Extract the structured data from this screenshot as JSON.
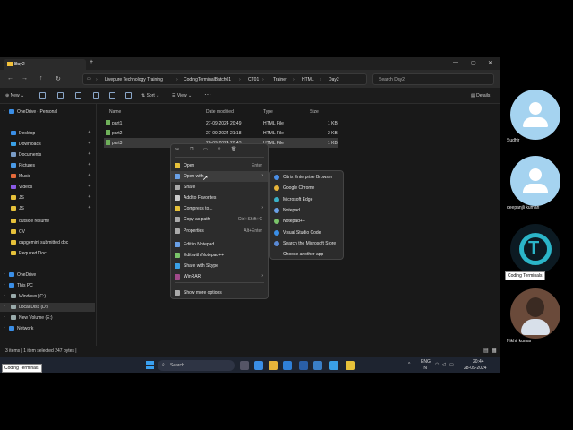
{
  "explorer": {
    "tab_title": "Day2",
    "tab_close": "✕",
    "new_tab": "+",
    "window_controls": [
      "—",
      "▢",
      "✕"
    ],
    "breadcrumb": [
      "Livepure Technology Training",
      "CodingTerminalBatch01",
      "CT01",
      "Trainer",
      "HTML",
      "Day2"
    ],
    "search_placeholder": "Search Day2",
    "toolbar": {
      "new": "New",
      "sort": "Sort",
      "view": "View",
      "more": "···",
      "details": "Details"
    },
    "columns": {
      "name": "Name",
      "date": "Date modified",
      "type": "Type",
      "size": "Size"
    },
    "files": [
      {
        "name": "part1",
        "date": "27-09-2024 20:49",
        "type": "HTML File",
        "size": "1 KB"
      },
      {
        "name": "part2",
        "date": "27-09-2024 21:18",
        "type": "HTML File",
        "size": "2 KB"
      },
      {
        "name": "part3",
        "date": "28-09-2024 20:43",
        "type": "HTML File",
        "size": "1 KB"
      }
    ],
    "sidebar": [
      {
        "label": "OneDrive - Personal",
        "color": "#3a8ee6"
      },
      {
        "label": "Desktop",
        "color": "#3a8ee6",
        "pin": true
      },
      {
        "label": "Downloads",
        "color": "#3aa0e6",
        "pin": true
      },
      {
        "label": "Documents",
        "color": "#7a9cc6",
        "pin": true
      },
      {
        "label": "Pictures",
        "color": "#4a9ae6",
        "pin": true
      },
      {
        "label": "Music",
        "color": "#e66a3a",
        "pin": true
      },
      {
        "label": "Videos",
        "color": "#8a5ae6",
        "pin": true
      },
      {
        "label": "JS",
        "color": "#e6c13a",
        "pin": true
      },
      {
        "label": "JS",
        "color": "#e6c13a",
        "pin": true
      },
      {
        "label": "outside resume",
        "color": "#e6c13a"
      },
      {
        "label": "CV",
        "color": "#e6c13a"
      },
      {
        "label": "capgemini submitted doc",
        "color": "#e6c13a"
      },
      {
        "label": "Required Doc",
        "color": "#e6c13a"
      },
      {
        "label": "OneDrive",
        "color": "#3a8ee6"
      },
      {
        "label": "This PC",
        "color": "#3a8ee6"
      },
      {
        "label": "Windows (C:)",
        "color": "#9aa"
      },
      {
        "label": "Local Disk (D:)",
        "color": "#9aa"
      },
      {
        "label": "New Volume (E:)",
        "color": "#9aa"
      },
      {
        "label": "Network",
        "color": "#3a8ee6"
      }
    ],
    "status": "3 items  |  1 item selected  247 bytes  |"
  },
  "context_menu": {
    "items": [
      {
        "label": "Open",
        "key": "Enter",
        "color": "#e6c13a"
      },
      {
        "label": "Open with",
        "arrow": "›",
        "color": "#6aa0e6"
      },
      {
        "label": "Share",
        "color": "#aaa"
      },
      {
        "label": "Add to Favorites",
        "color": "#ccc"
      },
      {
        "label": "Compress to...",
        "arrow": "›",
        "color": "#e6c13a"
      },
      {
        "label": "Copy as path",
        "key": "Ctrl+Shift+C",
        "color": "#aaa"
      },
      {
        "label": "Properties",
        "key": "Alt+Enter",
        "color": "#aaa"
      },
      {
        "label": "Edit in Notepad",
        "color": "#6aa0e6"
      },
      {
        "label": "Edit with Notepad++",
        "color": "#7ac46a"
      },
      {
        "label": "Share with Skype",
        "color": "#3aa0e6"
      },
      {
        "label": "WinRAR",
        "arrow": "›",
        "color": "#a04a8a"
      },
      {
        "label": "Show more options",
        "color": "#aaa"
      }
    ]
  },
  "open_with": {
    "items": [
      {
        "label": "Citrix Enterprise Browser",
        "color": "#4a8ee6"
      },
      {
        "label": "Google Chrome",
        "color": "#e6b43a"
      },
      {
        "label": "Microsoft Edge",
        "color": "#3ab0c6"
      },
      {
        "label": "Notepad",
        "color": "#6aa0e6"
      },
      {
        "label": "Notepad++",
        "color": "#7ac46a"
      },
      {
        "label": "Visual Studio Code",
        "color": "#3a8ee6"
      },
      {
        "label": "Search the Microsoft Store",
        "color": "#5a8ad6"
      },
      {
        "label": "Choose another app",
        "color": "transparent"
      }
    ]
  },
  "taskbar": {
    "search": "Search",
    "tray_lang": "ENG",
    "tray_region": "IN",
    "time": "20:44",
    "date": "28-09-2024"
  },
  "participants": [
    {
      "name": "Sudhir"
    },
    {
      "name": "deepanjli kumari"
    },
    {
      "name": "Coding Terminals"
    },
    {
      "name": "Nikhil kumar"
    }
  ],
  "presenter_badge": "Coding Terminals"
}
